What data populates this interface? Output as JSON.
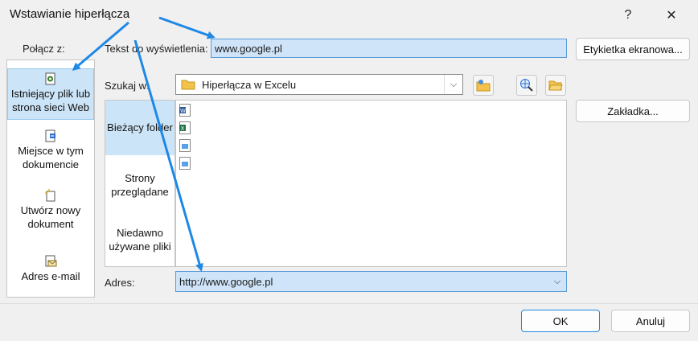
{
  "window": {
    "title": "Wstawianie hiperłącza",
    "help_glyph": "?",
    "close_glyph": "✕"
  },
  "link_to": {
    "label": "Połącz z:",
    "items": [
      {
        "icon": "existing-file-web-icon",
        "line1": "Istniejący plik lub",
        "line2": "strona sieci Web"
      },
      {
        "icon": "place-in-document-icon",
        "line1": "Miejsce w tym",
        "line2": "dokumencie"
      },
      {
        "icon": "new-document-icon",
        "line1": "Utwórz nowy",
        "line2": "dokument"
      },
      {
        "icon": "email-address-icon",
        "line1": "Adres e-mail",
        "line2": ""
      }
    ]
  },
  "display_text": {
    "label": "Tekst do wyświetlenia:",
    "value": "www.google.pl"
  },
  "screentip_button": "Etykietka ekranowa...",
  "look_in": {
    "label": "Szukaj w:",
    "value": "Hiperłącza w Excelu"
  },
  "bookmark_button": "Zakładka...",
  "sources": [
    {
      "line1": "Bieżący folder",
      "line2": ""
    },
    {
      "line1": "Strony",
      "line2": "przeglądane"
    },
    {
      "line1": "Niedawno",
      "line2": "używane pliki"
    }
  ],
  "files": [
    {
      "icon": "word-file-icon"
    },
    {
      "icon": "excel-file-icon"
    },
    {
      "icon": "image-file-icon"
    },
    {
      "icon": "image-file-icon"
    }
  ],
  "address": {
    "label": "Adres:",
    "value": "http://www.google.pl"
  },
  "ok_button": "OK",
  "cancel_button": "Anuluj",
  "colors": {
    "accent": "#1e88e5",
    "selection": "#cce4f7",
    "highlight_field": "#cfe4f8"
  }
}
